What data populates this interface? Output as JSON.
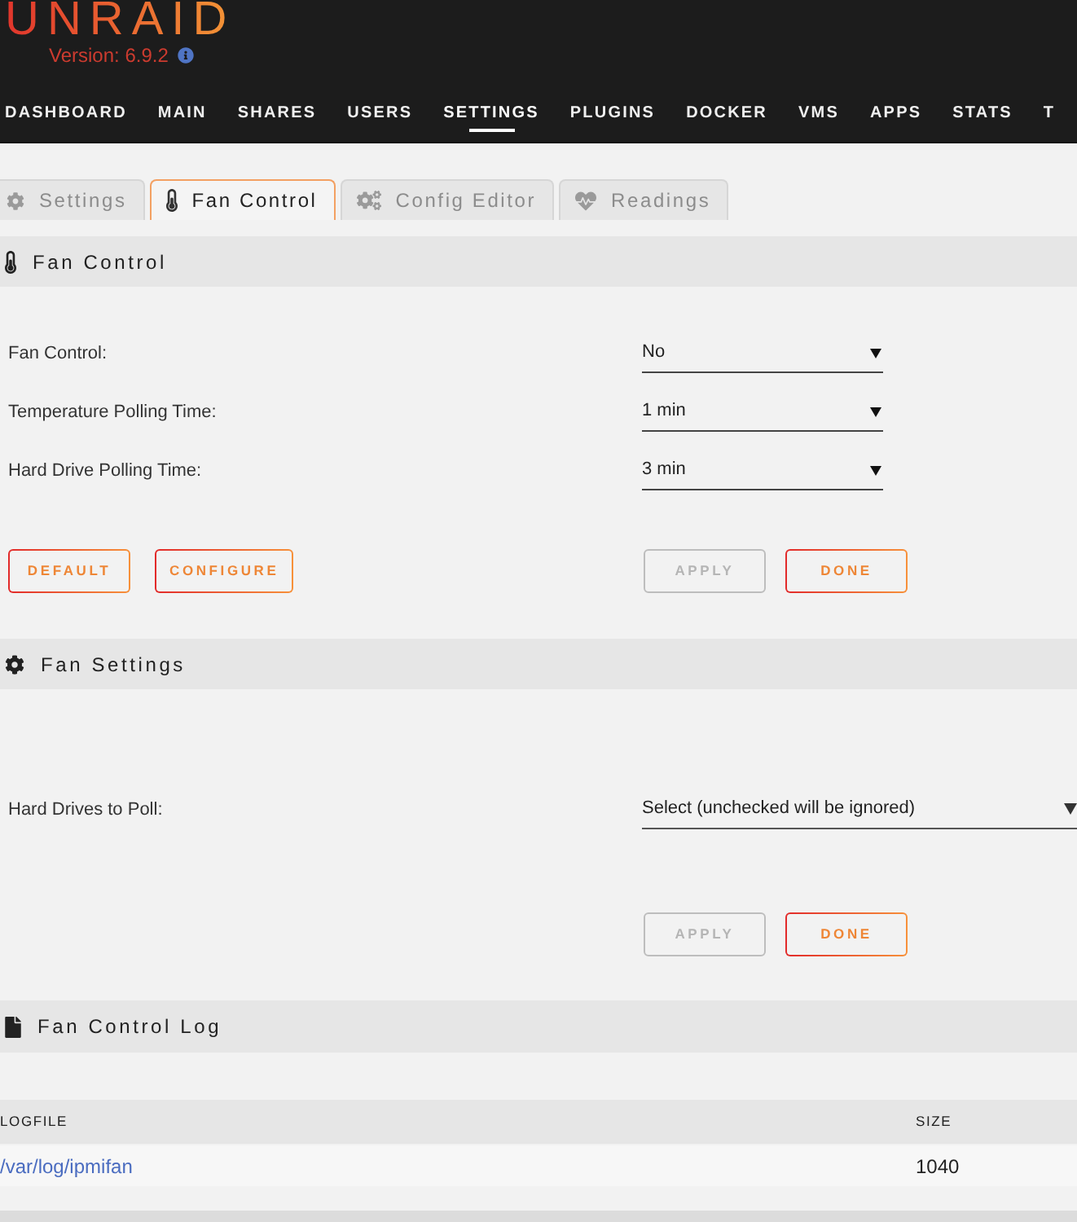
{
  "header": {
    "logo": "UNRAID",
    "version": "Version: 6.9.2"
  },
  "nav": [
    {
      "label": "DASHBOARD",
      "selected": false
    },
    {
      "label": "MAIN",
      "selected": false
    },
    {
      "label": "SHARES",
      "selected": false
    },
    {
      "label": "USERS",
      "selected": false
    },
    {
      "label": "SETTINGS",
      "selected": true
    },
    {
      "label": "PLUGINS",
      "selected": false
    },
    {
      "label": "DOCKER",
      "selected": false
    },
    {
      "label": "VMS",
      "selected": false
    },
    {
      "label": "APPS",
      "selected": false
    },
    {
      "label": "STATS",
      "selected": false
    },
    {
      "label": "T",
      "selected": false
    }
  ],
  "tabs": [
    {
      "label": "Settings",
      "selected": false
    },
    {
      "label": "Fan Control",
      "selected": true
    },
    {
      "label": "Config Editor",
      "selected": false
    },
    {
      "label": "Readings",
      "selected": false
    }
  ],
  "sections": [
    {
      "title": "Fan Control",
      "fields": [
        {
          "kind": "select",
          "label": "Fan Control:",
          "value": "No"
        },
        {
          "kind": "select",
          "label": "Temperature Polling Time:",
          "value": "1 min"
        },
        {
          "kind": "select",
          "label": "Hard Drive Polling Time:",
          "value": "3 min"
        }
      ],
      "buttons_left": [
        {
          "label": "DEFAULT",
          "disabled": false
        },
        {
          "label": "CONFIGURE",
          "disabled": false
        }
      ],
      "buttons_right": [
        {
          "label": "APPLY",
          "disabled": true
        },
        {
          "label": "DONE",
          "disabled": false
        }
      ]
    },
    {
      "title": "Fan Settings",
      "fields": [
        {
          "kind": "multiselect",
          "label": "Hard Drives to Poll:",
          "value": "Select (unchecked will be ignored)"
        }
      ],
      "buttons_right": [
        {
          "label": "APPLY",
          "disabled": true
        },
        {
          "label": "DONE",
          "disabled": false
        }
      ]
    },
    {
      "title": "Fan Control Log",
      "table": {
        "columns": [
          "LOGFILE",
          "SIZE"
        ],
        "rows": [
          [
            "/var/log/ipmifan",
            "1040"
          ]
        ]
      }
    }
  ]
}
